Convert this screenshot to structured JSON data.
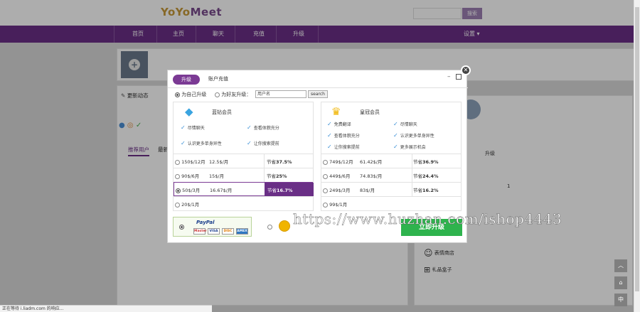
{
  "header": {
    "logo_part1": "YoYo",
    "logo_part2": "Meet",
    "search_button": "搜索"
  },
  "nav": {
    "items": [
      "首页",
      "主页",
      "聊天",
      "充值",
      "升级"
    ],
    "settings": "设置"
  },
  "background": {
    "dynamic_label": "更新动态",
    "recommend_tab": "推荐用户",
    "partial_tab": "最新",
    "right_col_header": "升级",
    "right_col_value": "1",
    "emoji_shop": "表情商店",
    "gift_box": "礼品盒子"
  },
  "modal": {
    "tab_upgrade": "升级",
    "tab_recharge": "账户充值",
    "option_self": "为自己升级",
    "option_friend": "为好友升级：",
    "username_placeholder": "用户名",
    "search_button": "search",
    "diamond": {
      "title": "蓝钻会员",
      "features": [
        "尽情聊天",
        "查看体貌充分",
        "认识更多单身异性",
        "让你搜索提前"
      ],
      "plans": [
        {
          "period": "150$/12月",
          "monthly": "12.5$/月",
          "save_label": "节省",
          "save_value": "37.5%"
        },
        {
          "period": "90$/6月",
          "monthly": "15$/月",
          "save_label": "节省",
          "save_value": "25%"
        },
        {
          "period": "50$/3月",
          "monthly": "16.67$/月",
          "save_label": "节省",
          "save_value": "16.7%"
        },
        {
          "period": "20$/1月",
          "monthly": "",
          "save_label": "",
          "save_value": ""
        }
      ]
    },
    "crown": {
      "title": "皇冠会员",
      "features": [
        "免费翻译",
        "尽情聊天",
        "查看体貌充分",
        "认识更多单身异性",
        "让你搜索提前",
        "更多展示机会"
      ],
      "plans": [
        {
          "period": "749$/12月",
          "monthly": "61.42$/月",
          "save_label": "节省",
          "save_value": "36.9%"
        },
        {
          "period": "449$/6月",
          "monthly": "74.83$/月",
          "save_label": "节省",
          "save_value": "24.4%"
        },
        {
          "period": "249$/3月",
          "monthly": "83$/月",
          "save_label": "节省",
          "save_value": "16.2%"
        },
        {
          "period": "99$/1月",
          "monthly": "",
          "save_label": "",
          "save_value": ""
        }
      ]
    },
    "paypal_label": "PayPal",
    "cards": [
      "Master",
      "VISA",
      "DISC",
      "AMEX"
    ],
    "buy_button": "立即升级"
  },
  "watermark": "https://www.huzhan.com/ishop4443",
  "status_bar": "正在等待 i.liadm.com 的响应...",
  "float_buttons": [
    "︿",
    "⌂",
    "中"
  ],
  "colors": {
    "brand": "#6a2f86",
    "buy": "#2eb34d",
    "check": "#3a8fd6"
  }
}
